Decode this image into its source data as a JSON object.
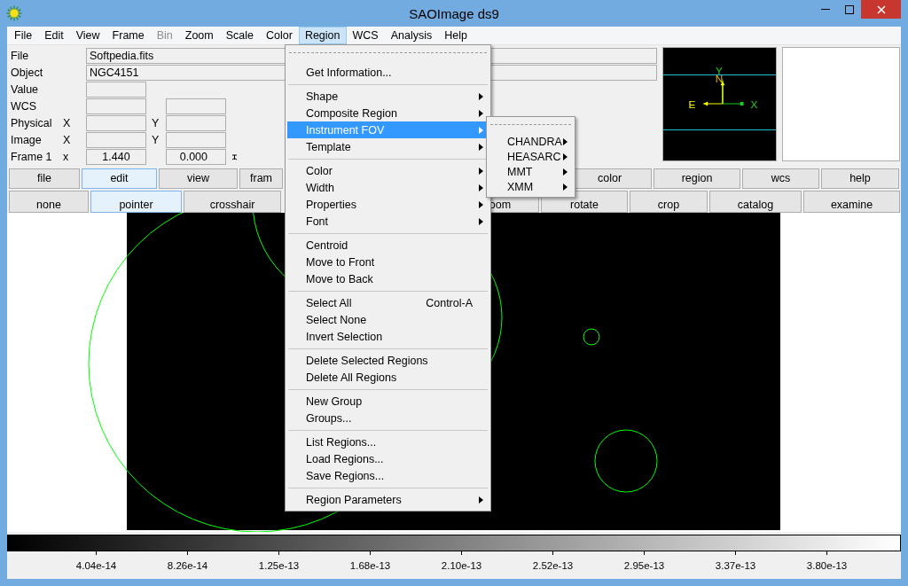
{
  "window": {
    "title": "SAOImage ds9"
  },
  "menubar": [
    {
      "label": "File",
      "selected": false,
      "disabled": false
    },
    {
      "label": "Edit",
      "selected": false,
      "disabled": false
    },
    {
      "label": "View",
      "selected": false,
      "disabled": false
    },
    {
      "label": "Frame",
      "selected": false,
      "disabled": false
    },
    {
      "label": "Bin",
      "selected": false,
      "disabled": true
    },
    {
      "label": "Zoom",
      "selected": false,
      "disabled": false
    },
    {
      "label": "Scale",
      "selected": false,
      "disabled": false
    },
    {
      "label": "Color",
      "selected": false,
      "disabled": false
    },
    {
      "label": "Region",
      "selected": true,
      "disabled": false
    },
    {
      "label": "WCS",
      "selected": false,
      "disabled": false
    },
    {
      "label": "Analysis",
      "selected": false,
      "disabled": false
    },
    {
      "label": "Help",
      "selected": false,
      "disabled": false
    }
  ],
  "info_panel": {
    "rows": [
      {
        "kind": "wide",
        "label": "File",
        "value": "Softpedia.fits"
      },
      {
        "kind": "wide",
        "label": "Object",
        "value": "NGC4151"
      },
      {
        "kind": "single",
        "label": "Value"
      },
      {
        "kind": "pair",
        "label": "WCS"
      },
      {
        "kind": "pair",
        "label": "Physical",
        "x_label": "X",
        "y_label": "Y"
      },
      {
        "kind": "pair",
        "label": "Image",
        "x_label": "X",
        "y_label": "Y"
      },
      {
        "kind": "frame",
        "label": "Frame 1",
        "x_label": "x",
        "x_value": "1.440",
        "y_value": "0.000"
      }
    ]
  },
  "panner": {
    "y_axis": "Y",
    "north": "N",
    "east": "E",
    "x_axis": "X"
  },
  "button_rows": [
    [
      {
        "label": "file",
        "selected": false
      },
      {
        "label": "edit",
        "selected": true
      },
      {
        "label": "view",
        "selected": false
      },
      {
        "label": "fram",
        "selected": false
      },
      {
        "label": "color",
        "selected": false
      },
      {
        "label": "region",
        "selected": false
      },
      {
        "label": "wcs",
        "selected": false
      },
      {
        "label": "help",
        "selected": false
      }
    ],
    [
      {
        "label": "none",
        "selected": false
      },
      {
        "label": "pointer",
        "selected": true
      },
      {
        "label": "crosshair",
        "selected": false
      },
      {
        "label": "oom",
        "selected": false
      },
      {
        "label": "rotate",
        "selected": false
      },
      {
        "label": "crop",
        "selected": false
      },
      {
        "label": "catalog",
        "selected": false
      },
      {
        "label": "examine",
        "selected": false
      }
    ]
  ],
  "colorbar": {
    "ticks": [
      "4.04e-14",
      "8.26e-14",
      "1.25e-13",
      "1.68e-13",
      "2.10e-13",
      "2.52e-13",
      "2.95e-13",
      "3.37e-13",
      "3.80e-13"
    ]
  },
  "region_menu": {
    "items": [
      {
        "kind": "tearoff"
      },
      {
        "kind": "item",
        "label": "Get Information...",
        "submenu": false,
        "selected": false
      },
      {
        "kind": "separator"
      },
      {
        "kind": "item",
        "label": "Shape",
        "submenu": true,
        "selected": false
      },
      {
        "kind": "item",
        "label": "Composite Region",
        "submenu": true,
        "selected": false
      },
      {
        "kind": "item",
        "label": "Instrument FOV",
        "submenu": true,
        "selected": true
      },
      {
        "kind": "item",
        "label": "Template",
        "submenu": true,
        "selected": false
      },
      {
        "kind": "separator"
      },
      {
        "kind": "item",
        "label": "Color",
        "submenu": true,
        "selected": false
      },
      {
        "kind": "item",
        "label": "Width",
        "submenu": true,
        "selected": false
      },
      {
        "kind": "item",
        "label": "Properties",
        "submenu": true,
        "selected": false
      },
      {
        "kind": "item",
        "label": "Font",
        "submenu": true,
        "selected": false
      },
      {
        "kind": "separator"
      },
      {
        "kind": "item",
        "label": "Centroid",
        "submenu": false,
        "selected": false
      },
      {
        "kind": "item",
        "label": "Move to Front",
        "submenu": false,
        "selected": false
      },
      {
        "kind": "item",
        "label": "Move to Back",
        "submenu": false,
        "selected": false
      },
      {
        "kind": "separator"
      },
      {
        "kind": "item",
        "label": "Select All",
        "shortcut": "Control-A",
        "submenu": false,
        "selected": false
      },
      {
        "kind": "item",
        "label": "Select None",
        "submenu": false,
        "selected": false
      },
      {
        "kind": "item",
        "label": "Invert Selection",
        "submenu": false,
        "selected": false
      },
      {
        "kind": "separator"
      },
      {
        "kind": "item",
        "label": "Delete Selected Regions",
        "submenu": false,
        "selected": false
      },
      {
        "kind": "item",
        "label": "Delete All Regions",
        "submenu": false,
        "selected": false
      },
      {
        "kind": "separator"
      },
      {
        "kind": "item",
        "label": "New Group",
        "submenu": false,
        "selected": false
      },
      {
        "kind": "item",
        "label": "Groups...",
        "submenu": false,
        "selected": false
      },
      {
        "kind": "separator"
      },
      {
        "kind": "item",
        "label": "List Regions...",
        "submenu": false,
        "selected": false
      },
      {
        "kind": "item",
        "label": "Load Regions...",
        "submenu": false,
        "selected": false
      },
      {
        "kind": "item",
        "label": "Save Regions...",
        "submenu": false,
        "selected": false
      },
      {
        "kind": "separator"
      },
      {
        "kind": "item",
        "label": "Region Parameters",
        "submenu": true,
        "selected": false
      }
    ]
  },
  "fov_submenu": {
    "items": [
      {
        "kind": "tearoff"
      },
      {
        "kind": "item",
        "label": "CHANDRA",
        "submenu": true,
        "selected": false
      },
      {
        "kind": "item",
        "label": "HEASARC",
        "submenu": true,
        "selected": false
      },
      {
        "kind": "item",
        "label": "MMT",
        "submenu": true,
        "selected": false
      },
      {
        "kind": "item",
        "label": "XMM",
        "submenu": true,
        "selected": false
      }
    ]
  }
}
